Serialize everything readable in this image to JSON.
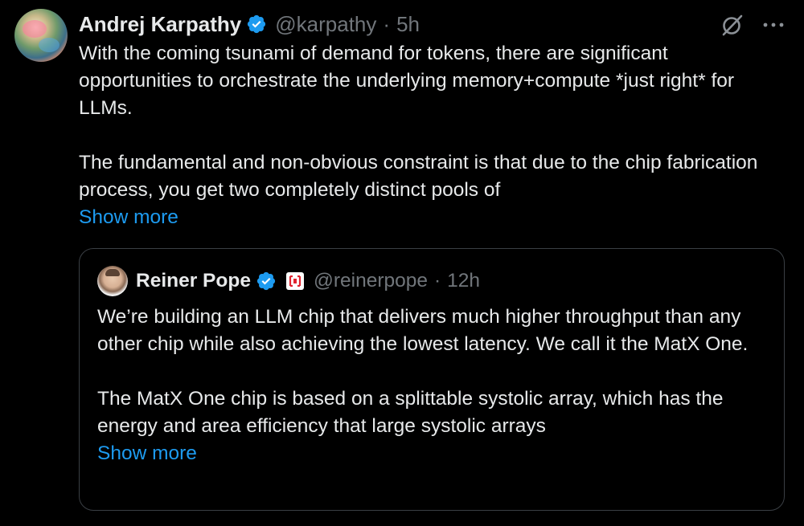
{
  "tweet": {
    "author": {
      "name": "Andrej Karpathy",
      "handle": "@karpathy",
      "separator": "·",
      "time": "5h"
    },
    "paragraphs": [
      "With the coming tsunami of demand for tokens, there are significant opportunities to orchestrate the underlying memory+compute *just right* for LLMs.",
      "The fundamental and non-obvious constraint is that due to the chip fabrication process, you get two completely distinct pools of"
    ],
    "show_more": "Show more",
    "actions": {
      "grok_icon": "grok-icon",
      "more_icon": "more-icon",
      "more_label": "···"
    }
  },
  "quote": {
    "author": {
      "name": "Reiner Pope",
      "handle": "@reinerpope",
      "separator": "·",
      "time": "12h"
    },
    "paragraphs": [
      "We’re building an LLM chip that delivers much higher throughput than any other chip while also achieving the lowest latency. We call it the MatX One.",
      "The MatX One chip is based on a splittable systolic array, which has the energy and area efficiency that large systolic arrays"
    ],
    "show_more": "Show more"
  },
  "colors": {
    "background": "#000000",
    "text": "#e7e9ea",
    "muted": "#71767b",
    "link": "#1d9bf0",
    "verified": "#1d9bf0",
    "border": "#3a3f44",
    "affiliate_badge": "#e0242f"
  }
}
